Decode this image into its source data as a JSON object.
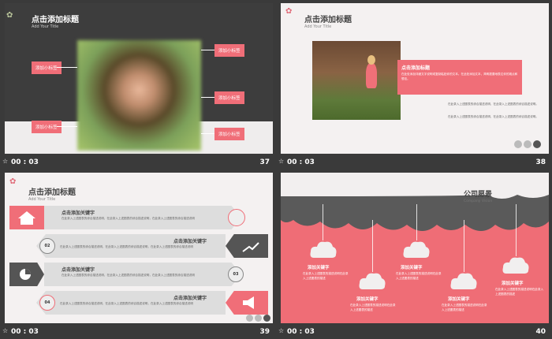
{
  "slides": [
    {
      "title": "点击添加标题",
      "subtitle": "Add Your Title",
      "tags": [
        "添加小标签",
        "添加小标签",
        "添加小标签",
        "添加小标签",
        "添加小标签"
      ],
      "time": "00 : 03",
      "number": "37"
    },
    {
      "title": "点击添加标题",
      "subtitle": "Add Your Title",
      "tag": "点击添加标题",
      "desc": "在此处添加详细文字说明或复制粘贴你的文本。在此处添加文本，简明扼要地表达你的观点和想法。",
      "bullets": [
        "在此录入上述图表的综合描述说明，在此录入上述图表的综合描述说明。",
        "在此录入上述图表的综合描述说明，在此录入上述图表的综合描述说明。"
      ],
      "time": "00 : 03",
      "number": "38"
    },
    {
      "title": "点击添加标题",
      "subtitle": "Add Your Title",
      "rows": [
        {
          "heading": "点击添加关键字",
          "text": "在此录入上述图表的综合描述说明，在此录入上述图表的综合描述说明，在此录入上述图表的综合描述说明",
          "badge": "01"
        },
        {
          "heading": "点击添加关键字",
          "text": "在此录入上述图表的综合描述说明，在此录入上述图表的综合描述说明，在此录入上述图表的综合描述说明",
          "badge": "02"
        },
        {
          "heading": "点击添加关键字",
          "text": "在此录入上述图表的综合描述说明，在此录入上述图表的综合描述说明，在此录入上述图表的综合描述说明",
          "badge": "03"
        },
        {
          "heading": "点击添加关键字",
          "text": "在此录入上述图表的综合描述说明，在此录入上述图表的综合描述说明，在此录入上述图表的综合描述说明",
          "badge": "04"
        }
      ],
      "time": "00 : 03",
      "number": "39"
    },
    {
      "title": "公司愿景",
      "subtitle": "Company Vision",
      "items": [
        {
          "heading": "添加关键字",
          "text": "在此录入上述图表的描述说明在此录入上述图表的描述"
        },
        {
          "heading": "添加关键字",
          "text": "在此录入上述图表的描述说明在此录入上述图表的描述"
        },
        {
          "heading": "添加关键字",
          "text": "在此录入上述图表的描述说明在此录入上述图表的描述"
        },
        {
          "heading": "添加关键字",
          "text": "在此录入上述图表的描述说明在此录入上述图表的描述"
        },
        {
          "heading": "添加关键字",
          "text": "在此录入上述图表的描述说明在此录入上述图表的描述"
        }
      ],
      "time": "00 : 03",
      "number": "40"
    }
  ]
}
